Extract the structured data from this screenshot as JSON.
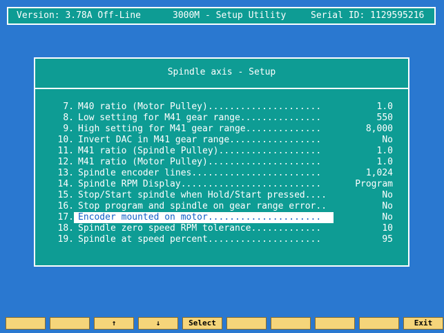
{
  "header": {
    "version": "Version: 3.78A Off-Line",
    "title": "3000M - Setup Utility",
    "serial": "Serial ID: 1129595216"
  },
  "dialog": {
    "title": "Spindle axis - Setup",
    "rows": [
      {
        "num": "7.",
        "label": "M40 ratio (Motor Pulley).....................",
        "value": "1.0"
      },
      {
        "num": "8.",
        "label": "Low setting for M41 gear range...............",
        "value": "550"
      },
      {
        "num": "9.",
        "label": "High setting for M41 gear range..............",
        "value": "8,000"
      },
      {
        "num": "10.",
        "label": "Invert DAC in M41 gear range.................",
        "value": "No"
      },
      {
        "num": "11.",
        "label": "M41 ratio (Spindle Pulley)...................",
        "value": "1.0"
      },
      {
        "num": "12.",
        "label": "M41 ratio (Motor Pulley).....................",
        "value": "1.0"
      },
      {
        "num": "13.",
        "label": "Spindle encoder lines........................",
        "value": "1,024"
      },
      {
        "num": "14.",
        "label": "Spindle RPM Display..........................",
        "value": "Program"
      },
      {
        "num": "15.",
        "label": "Stop/Start spindle when Hold/Start pressed....",
        "value": "No"
      },
      {
        "num": "16.",
        "label": "Stop program and spindle on gear range error..",
        "value": "No"
      },
      {
        "num": "17.",
        "label": "Encoder mounted on motor.....................",
        "value": "No"
      },
      {
        "num": "18.",
        "label": "Spindle zero speed RPM tolerance.............",
        "value": "10"
      },
      {
        "num": "19.",
        "label": "Spindle at speed percent.....................",
        "value": "95"
      }
    ],
    "selected_row": "17."
  },
  "fkeys": [
    "",
    "",
    "↑",
    "↓",
    "Select",
    "",
    "",
    "",
    "",
    "Exit"
  ],
  "colors": {
    "background": "#2a78d0",
    "panel": "#0e9c94",
    "text": "#ffffff",
    "selection_text": "#1060c8",
    "fkey": "#f5d57a"
  }
}
